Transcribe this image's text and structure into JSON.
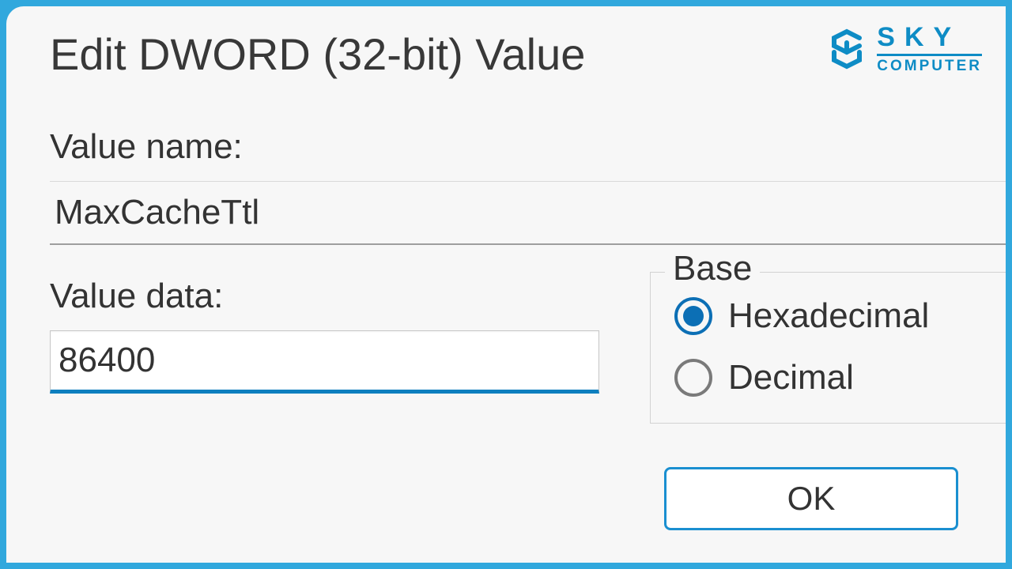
{
  "logo": {
    "top": "SKY",
    "bottom": "COMPUTER"
  },
  "dialog_title": "Edit DWORD (32-bit) Value",
  "value_name_label": "Value name:",
  "value_name": "MaxCacheTtl",
  "value_data_label": "Value data:",
  "value_data": "86400",
  "base": {
    "legend": "Base",
    "options": {
      "hex": "Hexadecimal",
      "dec": "Decimal"
    },
    "selected": "hex"
  },
  "ok_label": "OK"
}
